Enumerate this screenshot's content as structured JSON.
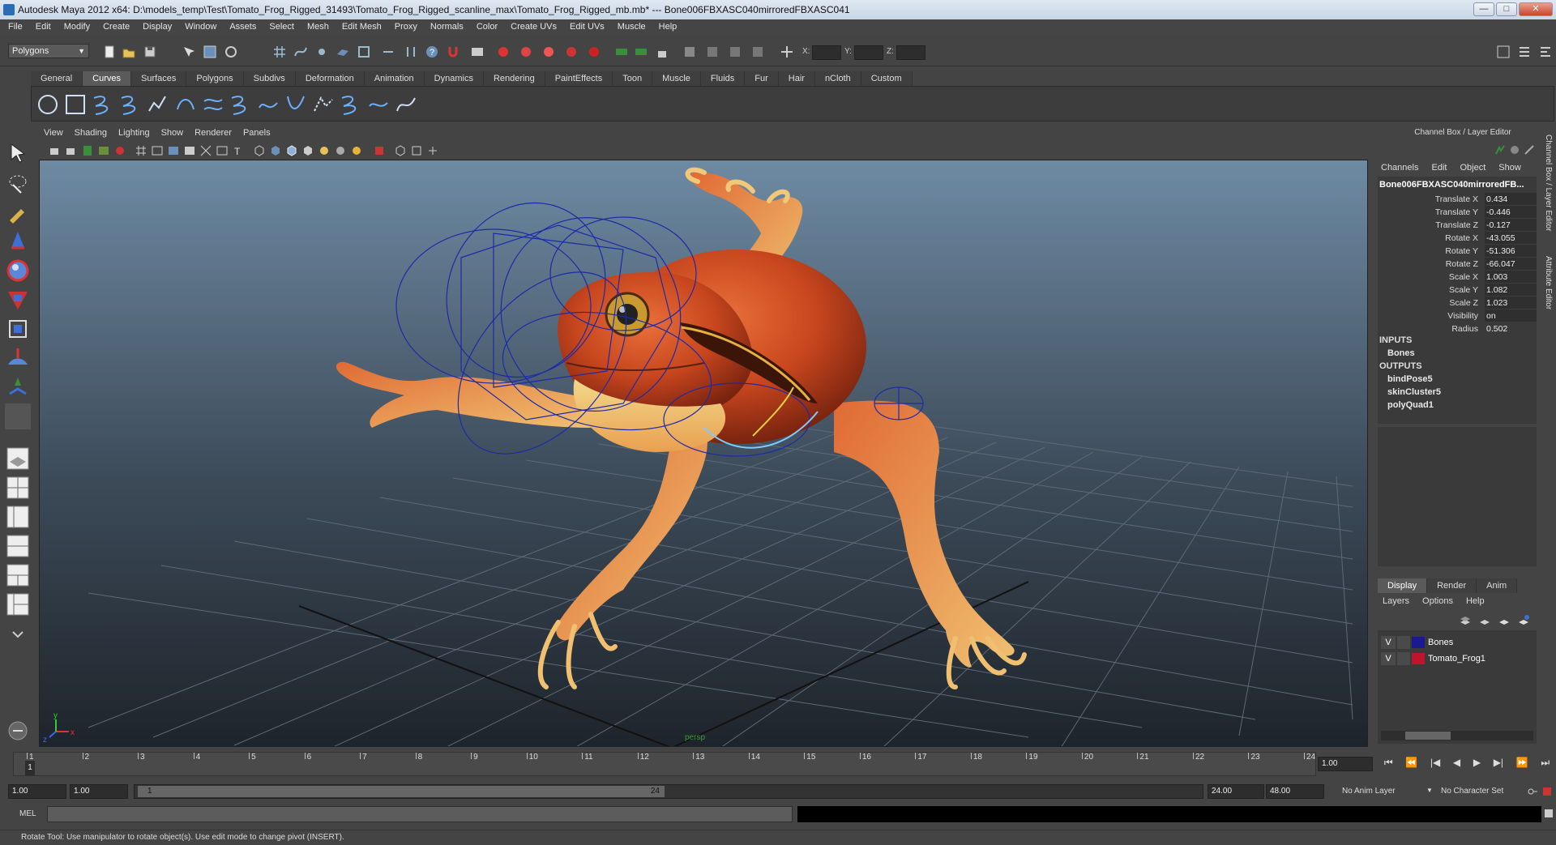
{
  "window": {
    "title": "Autodesk Maya 2012 x64: D:\\models_temp\\Test\\Tomato_Frog_Rigged_31493\\Tomato_Frog_Rigged_scanline_max\\Tomato_Frog_Rigged_mb.mb*  ---  Bone006FBXASC040mirroredFBXASC041",
    "minimize": "—",
    "maximize": "□",
    "close": "✕"
  },
  "menubar": [
    "File",
    "Edit",
    "Modify",
    "Create",
    "Display",
    "Window",
    "Assets",
    "Select",
    "Mesh",
    "Edit Mesh",
    "Proxy",
    "Normals",
    "Color",
    "Create UVs",
    "Edit UVs",
    "Muscle",
    "Help"
  ],
  "statusline": {
    "mode": "Polygons",
    "x_label": "X:",
    "y_label": "Y:",
    "z_label": "Z:"
  },
  "shelf": {
    "tabs": [
      "General",
      "Curves",
      "Surfaces",
      "Polygons",
      "Subdivs",
      "Deformation",
      "Animation",
      "Dynamics",
      "Rendering",
      "PaintEffects",
      "Toon",
      "Muscle",
      "Fluids",
      "Fur",
      "Hair",
      "nCloth",
      "Custom"
    ],
    "active_tab": "Curves"
  },
  "viewport": {
    "menu": [
      "View",
      "Shading",
      "Lighting",
      "Show",
      "Renderer",
      "Panels"
    ],
    "camera_label": "persp",
    "axis_x": "x",
    "axis_y": "y",
    "axis_z": "z"
  },
  "channel_box": {
    "header": "Channel Box / Layer Editor",
    "menu": [
      "Channels",
      "Edit",
      "Object",
      "Show"
    ],
    "object_name": "Bone006FBXASC040mirroredFB...",
    "channels": [
      {
        "label": "Translate X",
        "value": "0.434"
      },
      {
        "label": "Translate Y",
        "value": "-0.446"
      },
      {
        "label": "Translate Z",
        "value": "-0.127"
      },
      {
        "label": "Rotate X",
        "value": "-43.055"
      },
      {
        "label": "Rotate Y",
        "value": "-51.306"
      },
      {
        "label": "Rotate Z",
        "value": "-66.047"
      },
      {
        "label": "Scale X",
        "value": "1.003"
      },
      {
        "label": "Scale Y",
        "value": "1.082"
      },
      {
        "label": "Scale Z",
        "value": "1.023"
      },
      {
        "label": "Visibility",
        "value": "on"
      }
    ],
    "radius_label": "Radius",
    "radius_value": "0.502",
    "inputs_label": "INPUTS",
    "inputs": [
      "Bones"
    ],
    "outputs_label": "OUTPUTS",
    "outputs": [
      "bindPose5",
      "skinCluster5",
      "polyQuad1"
    ],
    "side_tab_1": "Channel Box / Layer Editor",
    "side_tab_2": "Attribute Editor"
  },
  "layer_editor": {
    "tabs": [
      "Display",
      "Render",
      "Anim"
    ],
    "active_tab": "Display",
    "menu": [
      "Layers",
      "Options",
      "Help"
    ],
    "layers": [
      {
        "visible": "V",
        "name": "Bones",
        "color": "#1a1a8c"
      },
      {
        "visible": "V",
        "name": "Tomato_Frog1",
        "color": "#c0142c"
      }
    ]
  },
  "timeline": {
    "ticks": [
      "1",
      "2",
      "3",
      "4",
      "5",
      "6",
      "7",
      "8",
      "9",
      "10",
      "11",
      "12",
      "13",
      "14",
      "15",
      "16",
      "17",
      "18",
      "19",
      "20",
      "21",
      "22",
      "23",
      "24"
    ],
    "current_frame_marker": "1",
    "current_time": "1.00"
  },
  "playback": {
    "buttons": [
      "⏮",
      "⏪",
      "|◀",
      "◀",
      "▶",
      "▶|",
      "⏩",
      "⏭"
    ]
  },
  "range": {
    "start_time": "1.00",
    "playback_start": "1.00",
    "range_start_label": "1",
    "range_end_label": "24",
    "playback_end": "24.00",
    "end_time": "48.00",
    "anim_layer": "No Anim Layer",
    "character_set": "No Character Set"
  },
  "command_line": {
    "label": "MEL"
  },
  "help_line": "Rotate Tool: Use manipulator to rotate object(s). Use edit mode to change pivot (INSERT)."
}
